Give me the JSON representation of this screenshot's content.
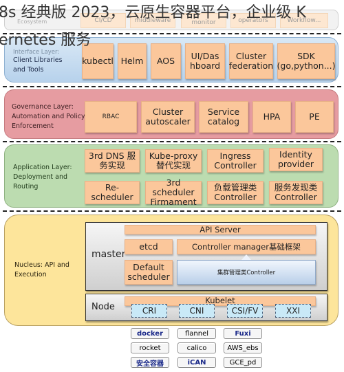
{
  "overlay_title": {
    "line1": "8s 经典版 2023，云原生容器平台，企业级 K",
    "line2": "ernetes 服务"
  },
  "ecosystem": {
    "label": "Ecosystem",
    "items": [
      "CI/CD",
      "middleware",
      "monitor",
      "operators",
      "Workflow..."
    ]
  },
  "interface_layer": {
    "label_top": "Interface Layer:",
    "label": "Client Libraries and Tools",
    "items": [
      "kubectl",
      "Helm",
      "AOS",
      "UI/Dashboard",
      "Cluster federation",
      "SDK (go,python...)"
    ]
  },
  "governance_layer": {
    "label": "Governance Layer: Automation and Policy Enforcement",
    "items": [
      "RBAC",
      "Cluster autoscaler",
      "Service catalog",
      "HPA",
      "PE"
    ]
  },
  "application_layer": {
    "label": "Application Layer: Deployment and Routing",
    "row1": [
      "3rd DNS 服务实现",
      "Kube-proxy替代实现",
      "Ingress Controller",
      "Identity provider"
    ],
    "row2": [
      "Re-scheduler",
      "3rd scheduler Firmament",
      "负载管理类 Controller",
      "服务发现类 Controller"
    ]
  },
  "nucleus": {
    "label": "Nucleus: API and Execution",
    "master": {
      "label": "master",
      "api_server": "API Server",
      "etcd": "etcd",
      "controller_manager": "Controller manager基础框架",
      "default_scheduler": "Default scheduler",
      "cluster_controller": "集群管理类Controller"
    },
    "node": {
      "label": "Node",
      "kubelet": "Kubelet",
      "interfaces": [
        "CRI",
        "CNI",
        "CSI/FV",
        "XXI"
      ]
    }
  },
  "plugins": [
    {
      "label": "docker",
      "bold": true
    },
    {
      "label": "flannel",
      "bold": false
    },
    {
      "label": "Fuxi",
      "bold": true
    },
    {
      "label": "rocket",
      "bold": false
    },
    {
      "label": "calico",
      "bold": false
    },
    {
      "label": "AWS_ebs",
      "bold": false
    },
    {
      "label": "安全容器",
      "bold": true
    },
    {
      "label": "iCAN",
      "bold": true
    },
    {
      "label": "GCE_pd",
      "bold": false
    }
  ],
  "colors": {
    "interface_bg": "#c5dcf0",
    "governance_bg": "#e59a9f",
    "application_bg": "#b9dcae",
    "nucleus_bg": "#fde59a",
    "box_bg": "#fbc79b",
    "plugin_bold": "#1b2a8a"
  }
}
